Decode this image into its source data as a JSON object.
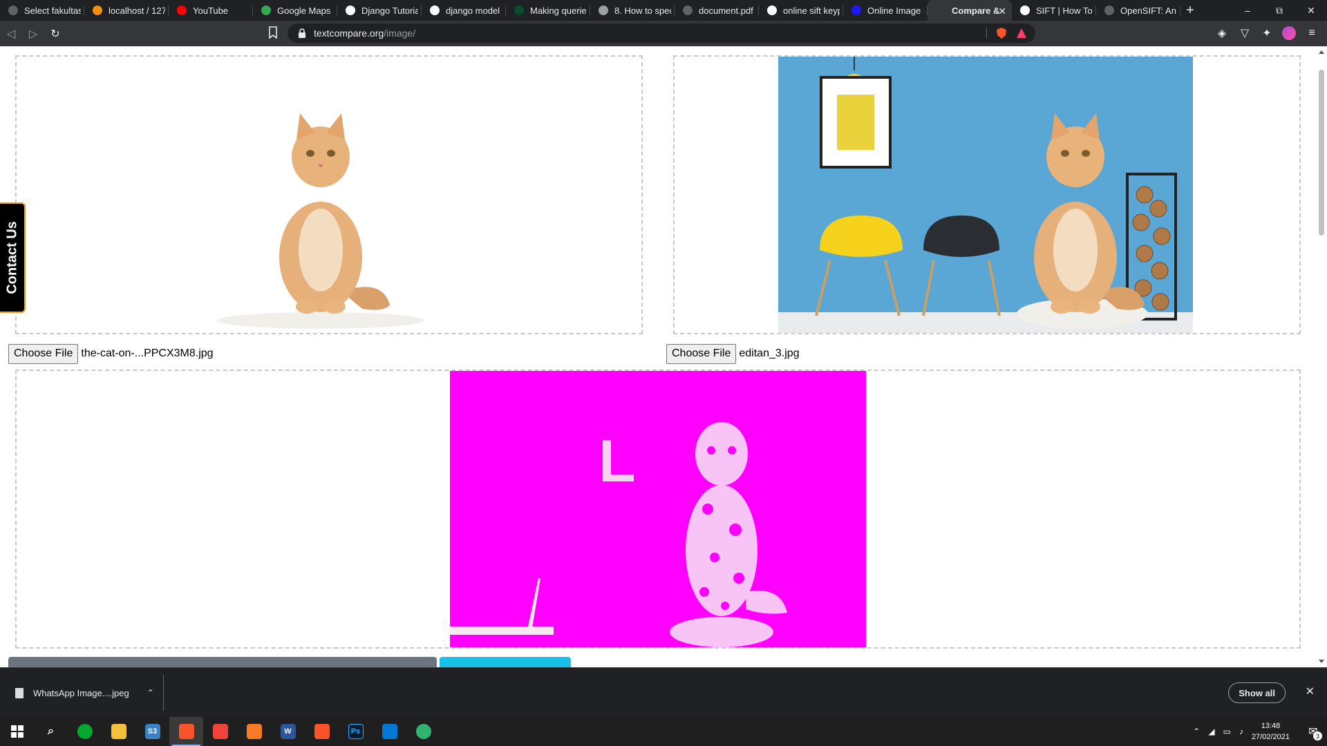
{
  "browser": {
    "tabs": [
      {
        "title": "Select fakultas t",
        "color": "#5f6368"
      },
      {
        "title": "localhost / 127.0",
        "color": "#f29111"
      },
      {
        "title": "YouTube",
        "color": "#ff0000"
      },
      {
        "title": "Google Maps",
        "color": "#34a853"
      },
      {
        "title": "Django Tutorial",
        "color": "#ffffff"
      },
      {
        "title": "django model c",
        "color": "#ffffff"
      },
      {
        "title": "Making queries",
        "color": "#0c4b33"
      },
      {
        "title": "8. How to specif",
        "color": "#9aa0a6"
      },
      {
        "title": "document.pdf",
        "color": "#5f6368"
      },
      {
        "title": "online sift keypo",
        "color": "#ffffff"
      },
      {
        "title": "Online Image D",
        "color": "#1a1aff"
      },
      {
        "title": "Compare &",
        "color": "#35363a",
        "active": true
      },
      {
        "title": "SIFT | How To U",
        "color": "#ffffff"
      },
      {
        "title": "OpenSIFT: An O",
        "color": "#5f6368"
      }
    ],
    "new_tab_label": "+",
    "address": {
      "domain": "textcompare.org",
      "path": "/image/"
    },
    "brave_shield_count": "3"
  },
  "page": {
    "contact_tab_label": "Contact Us",
    "left_file": {
      "button_label": "Choose File",
      "file_name": "the-cat-on-...PPCX3M8.jpg"
    },
    "right_file": {
      "button_label": "Choose File",
      "file_name": "editan_3.jpg"
    },
    "diff_color": "#ff00ff"
  },
  "downloads": {
    "item_name": "WhatsApp Image....jpeg",
    "show_all_label": "Show all"
  },
  "taskbar": {
    "time": "13:48",
    "date": "27/02/2021",
    "notification_count": "3"
  }
}
